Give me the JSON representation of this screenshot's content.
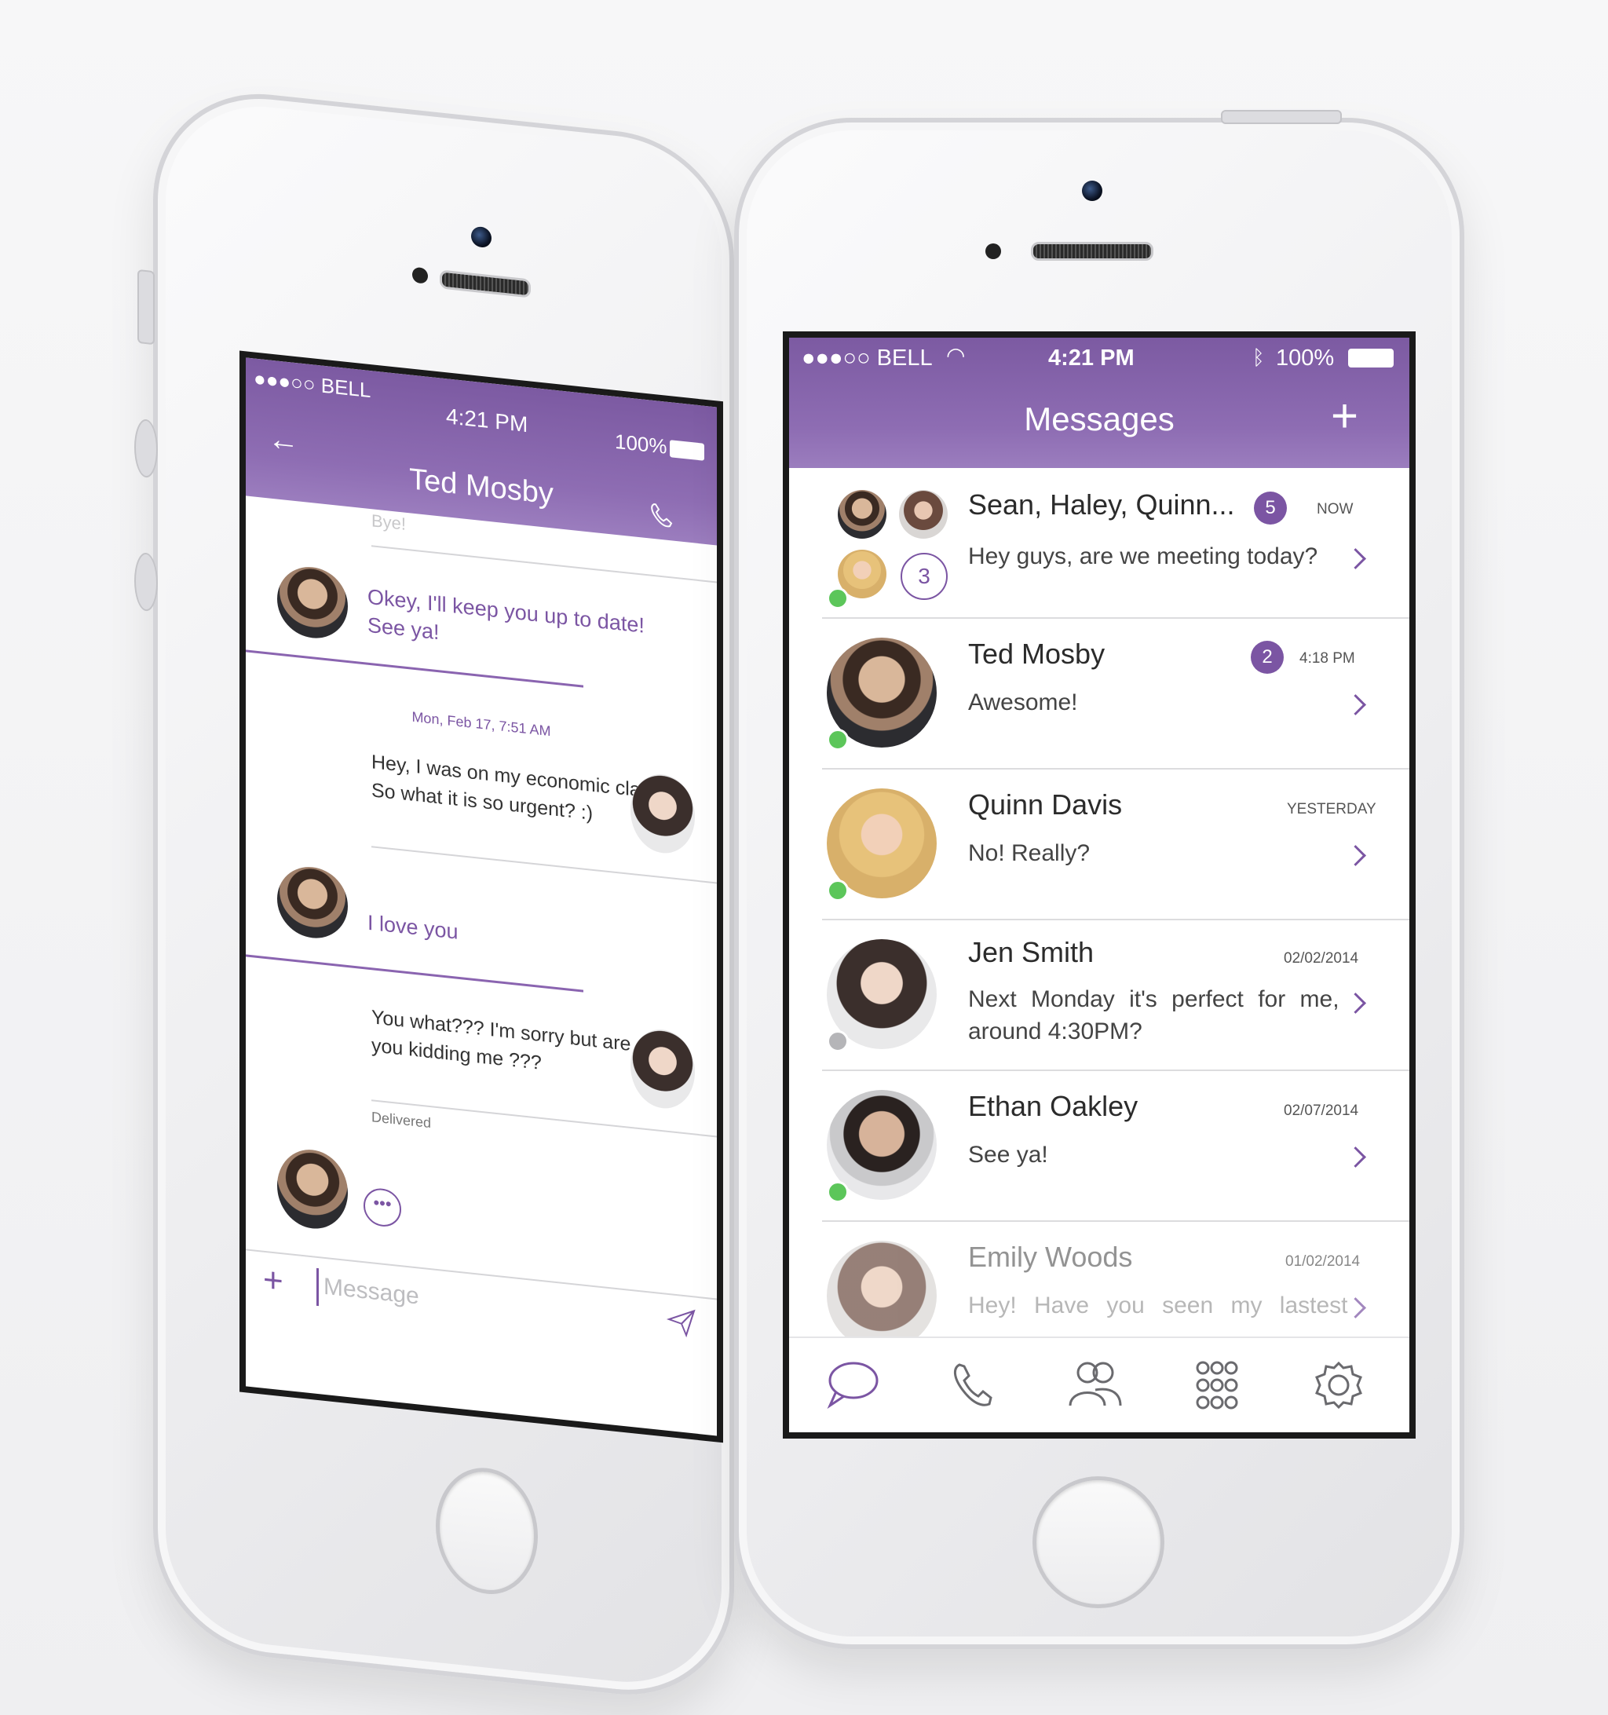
{
  "colors": {
    "accent": "#7b55a3",
    "header": "#8663ad",
    "online": "#5cc65a",
    "offline": "#b5b5b8"
  },
  "left_phone": {
    "status": {
      "carrier": "●●●○○ BELL",
      "time": "4:21 PM",
      "battery": "100%"
    },
    "header": {
      "title": "Ted Mosby"
    },
    "messages": {
      "faded": "Bye!",
      "m1_line1": "Okey, I'll keep you up to date!",
      "m1_line2": "See ya!",
      "date": "Mon, Feb 17, 7:51 AM",
      "m2_line1": "Hey, I was on my economic class.",
      "m2_line2": "So what it is so urgent? :)",
      "m3": "I love you",
      "m4_line1": "You what??? I'm sorry but are",
      "m4_line2": "you kidding me ???",
      "delivered": "Delivered"
    },
    "composer": {
      "placeholder": "Message"
    }
  },
  "right_phone": {
    "status": {
      "carrier": "●●●○○ BELL",
      "time": "4:21 PM",
      "battery": "100%"
    },
    "header": {
      "title": "Messages"
    },
    "conversations": [
      {
        "name": "Sean, Haley, Quinn...",
        "preview": "Hey guys, are we meeting today?",
        "time": "NOW",
        "badge": "5",
        "group_extra": "3"
      },
      {
        "name": "Ted Mosby",
        "preview": "Awesome!",
        "time": "4:18 PM",
        "badge": "2"
      },
      {
        "name": "Quinn Davis",
        "preview": "No! Really?",
        "time": "YESTERDAY"
      },
      {
        "name": "Jen Smith",
        "preview_line1": "Next Monday it's perfect for me,",
        "preview_line2": "around 4:30PM?",
        "time": "02/02/2014"
      },
      {
        "name": "Ethan Oakley",
        "preview": "See ya!",
        "time": "02/07/2014"
      },
      {
        "name": "Emily Woods",
        "preview": "Hey! Have you seen my lastest",
        "time": "01/02/2014"
      }
    ],
    "tabs": [
      "chat-icon",
      "phone-icon",
      "contacts-icon",
      "keypad-icon",
      "settings-icon"
    ]
  }
}
